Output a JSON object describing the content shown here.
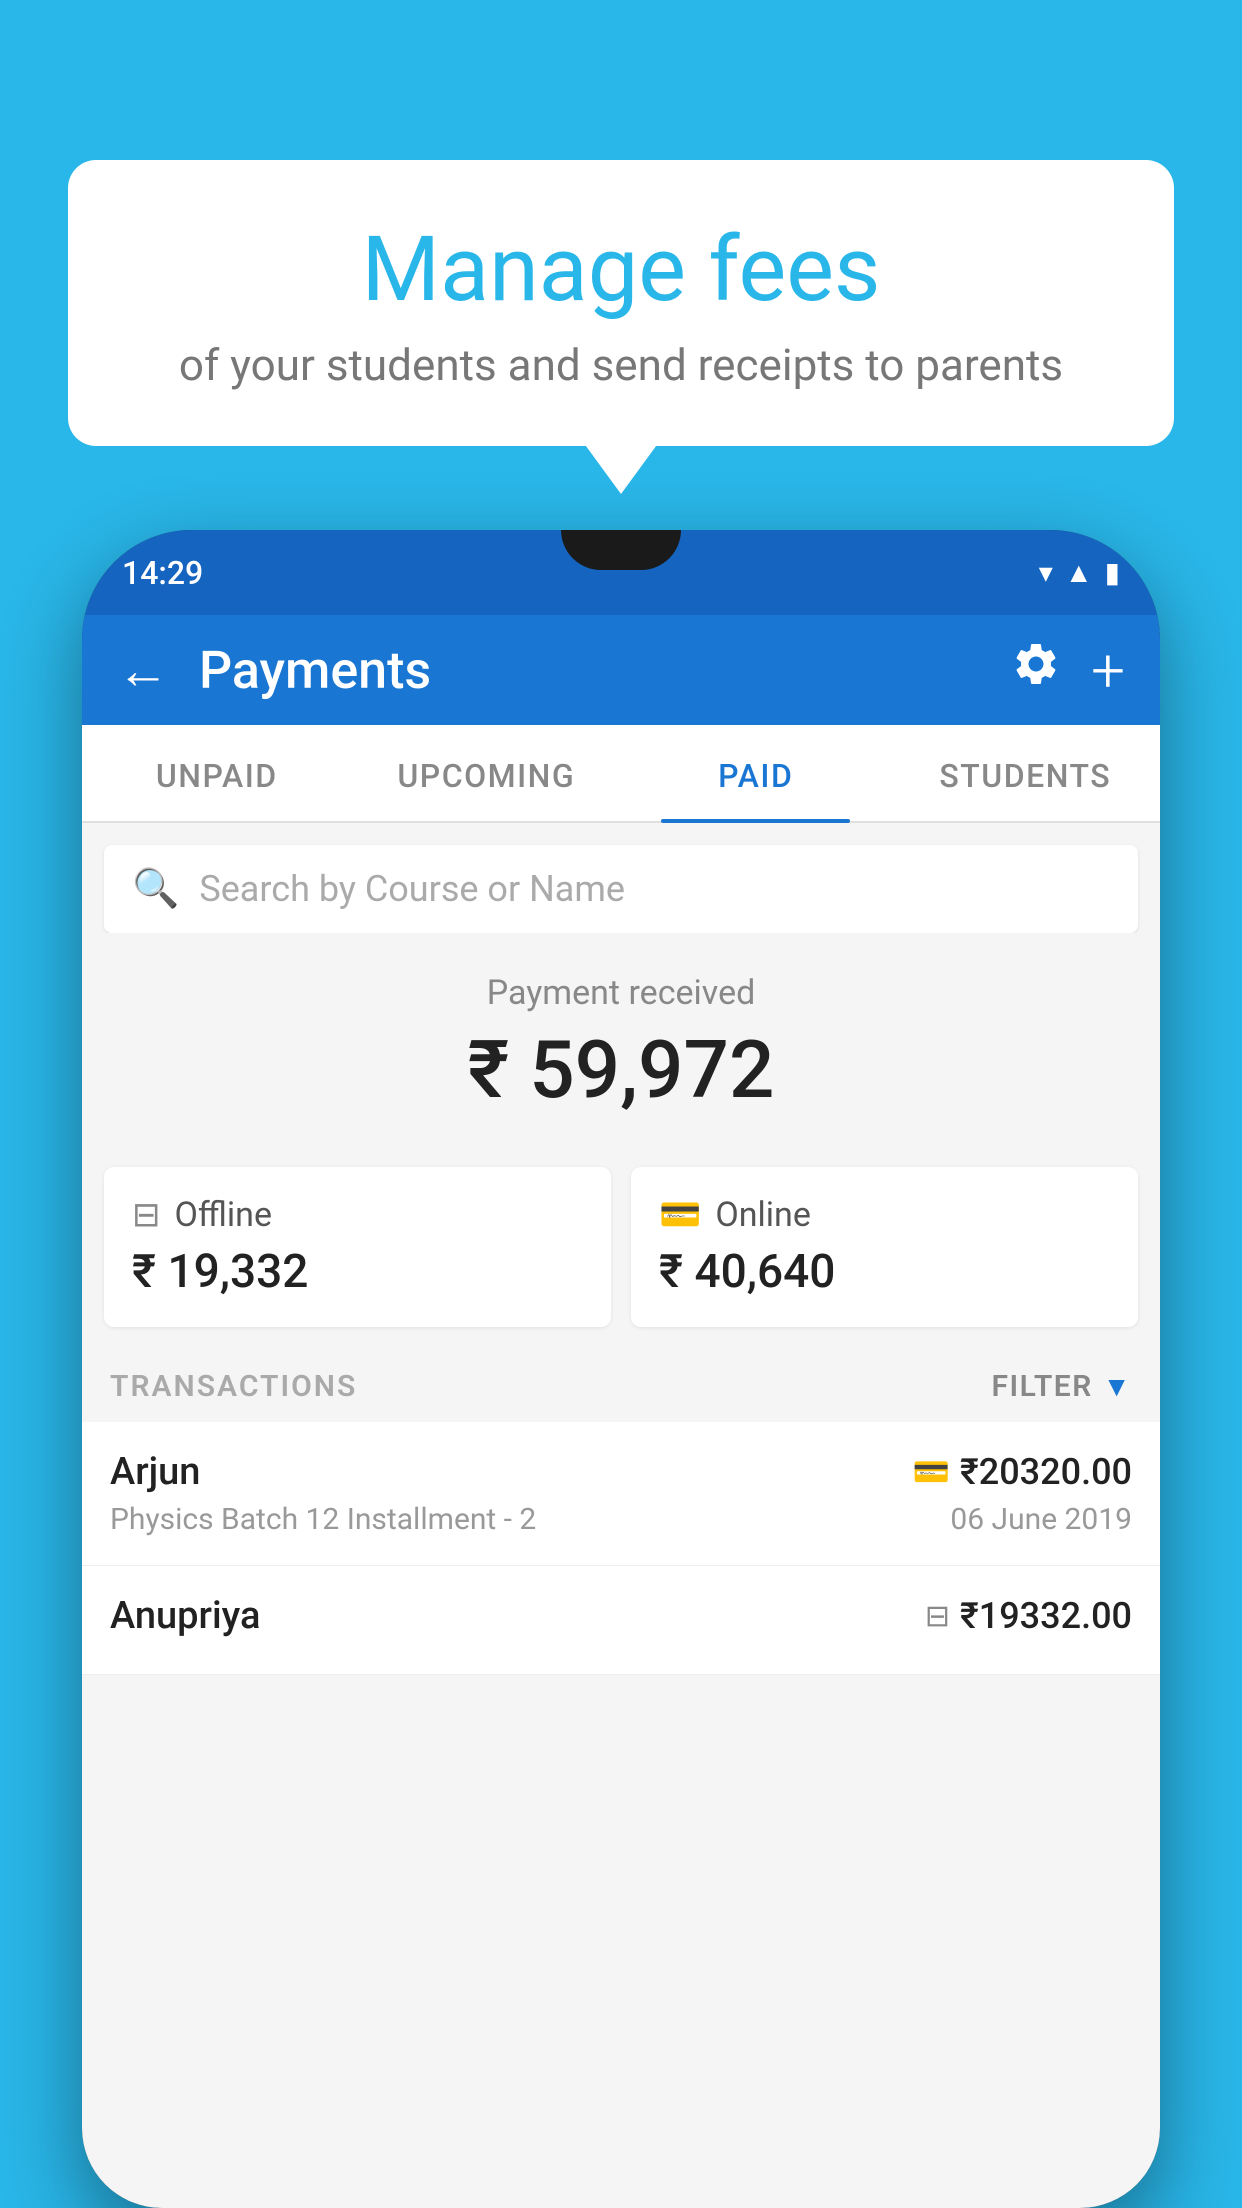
{
  "background_color": "#29b6e8",
  "speech_bubble": {
    "title": "Manage fees",
    "subtitle": "of your students and send receipts to parents"
  },
  "phone": {
    "status_bar": {
      "time": "14:29"
    },
    "app_header": {
      "title": "Payments",
      "back_label": "←"
    },
    "tabs": [
      {
        "label": "UNPAID",
        "active": false
      },
      {
        "label": "UPCOMING",
        "active": false
      },
      {
        "label": "PAID",
        "active": true
      },
      {
        "label": "STUDENTS",
        "active": false
      }
    ],
    "search": {
      "placeholder": "Search by Course or Name"
    },
    "payment_summary": {
      "label": "Payment received",
      "amount": "₹ 59,972",
      "offline_label": "Offline",
      "offline_amount": "₹ 19,332",
      "online_label": "Online",
      "online_amount": "₹ 40,640"
    },
    "transactions_section": {
      "label": "TRANSACTIONS",
      "filter_label": "FILTER"
    },
    "transactions": [
      {
        "name": "Arjun",
        "detail": "Physics Batch 12 Installment - 2",
        "amount": "₹20320.00",
        "date": "06 June 2019",
        "payment_type": "online"
      },
      {
        "name": "Anupriya",
        "detail": "",
        "amount": "₹19332.00",
        "date": "",
        "payment_type": "offline"
      }
    ]
  }
}
